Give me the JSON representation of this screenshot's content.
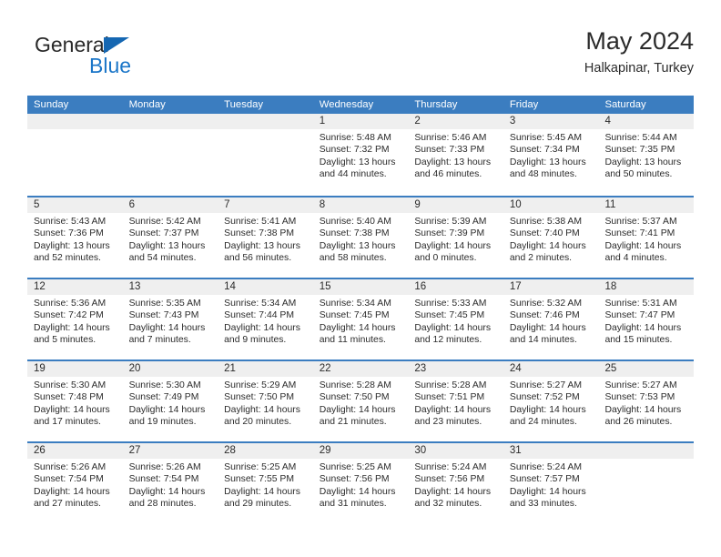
{
  "brand": {
    "name_top": "General",
    "name_bottom": "Blue",
    "triangle_color": "#1567b2",
    "blue_color": "#1b76c8"
  },
  "header": {
    "title": "May 2024",
    "subtitle": "Halkapinar, Turkey"
  },
  "theme": {
    "header_bg": "#3b7dc0",
    "header_text": "#ffffff",
    "day_band_bg": "#efefef",
    "row_separator": "#3b7dc0",
    "body_text": "#2b2b2b"
  },
  "weekday_headers": [
    "Sunday",
    "Monday",
    "Tuesday",
    "Wednesday",
    "Thursday",
    "Friday",
    "Saturday"
  ],
  "weeks": [
    [
      {
        "day": "",
        "lines": []
      },
      {
        "day": "",
        "lines": []
      },
      {
        "day": "",
        "lines": []
      },
      {
        "day": "1",
        "lines": [
          "Sunrise: 5:48 AM",
          "Sunset: 7:32 PM",
          "Daylight: 13 hours",
          "and 44 minutes."
        ]
      },
      {
        "day": "2",
        "lines": [
          "Sunrise: 5:46 AM",
          "Sunset: 7:33 PM",
          "Daylight: 13 hours",
          "and 46 minutes."
        ]
      },
      {
        "day": "3",
        "lines": [
          "Sunrise: 5:45 AM",
          "Sunset: 7:34 PM",
          "Daylight: 13 hours",
          "and 48 minutes."
        ]
      },
      {
        "day": "4",
        "lines": [
          "Sunrise: 5:44 AM",
          "Sunset: 7:35 PM",
          "Daylight: 13 hours",
          "and 50 minutes."
        ]
      }
    ],
    [
      {
        "day": "5",
        "lines": [
          "Sunrise: 5:43 AM",
          "Sunset: 7:36 PM",
          "Daylight: 13 hours",
          "and 52 minutes."
        ]
      },
      {
        "day": "6",
        "lines": [
          "Sunrise: 5:42 AM",
          "Sunset: 7:37 PM",
          "Daylight: 13 hours",
          "and 54 minutes."
        ]
      },
      {
        "day": "7",
        "lines": [
          "Sunrise: 5:41 AM",
          "Sunset: 7:38 PM",
          "Daylight: 13 hours",
          "and 56 minutes."
        ]
      },
      {
        "day": "8",
        "lines": [
          "Sunrise: 5:40 AM",
          "Sunset: 7:38 PM",
          "Daylight: 13 hours",
          "and 58 minutes."
        ]
      },
      {
        "day": "9",
        "lines": [
          "Sunrise: 5:39 AM",
          "Sunset: 7:39 PM",
          "Daylight: 14 hours",
          "and 0 minutes."
        ]
      },
      {
        "day": "10",
        "lines": [
          "Sunrise: 5:38 AM",
          "Sunset: 7:40 PM",
          "Daylight: 14 hours",
          "and 2 minutes."
        ]
      },
      {
        "day": "11",
        "lines": [
          "Sunrise: 5:37 AM",
          "Sunset: 7:41 PM",
          "Daylight: 14 hours",
          "and 4 minutes."
        ]
      }
    ],
    [
      {
        "day": "12",
        "lines": [
          "Sunrise: 5:36 AM",
          "Sunset: 7:42 PM",
          "Daylight: 14 hours",
          "and 5 minutes."
        ]
      },
      {
        "day": "13",
        "lines": [
          "Sunrise: 5:35 AM",
          "Sunset: 7:43 PM",
          "Daylight: 14 hours",
          "and 7 minutes."
        ]
      },
      {
        "day": "14",
        "lines": [
          "Sunrise: 5:34 AM",
          "Sunset: 7:44 PM",
          "Daylight: 14 hours",
          "and 9 minutes."
        ]
      },
      {
        "day": "15",
        "lines": [
          "Sunrise: 5:34 AM",
          "Sunset: 7:45 PM",
          "Daylight: 14 hours",
          "and 11 minutes."
        ]
      },
      {
        "day": "16",
        "lines": [
          "Sunrise: 5:33 AM",
          "Sunset: 7:45 PM",
          "Daylight: 14 hours",
          "and 12 minutes."
        ]
      },
      {
        "day": "17",
        "lines": [
          "Sunrise: 5:32 AM",
          "Sunset: 7:46 PM",
          "Daylight: 14 hours",
          "and 14 minutes."
        ]
      },
      {
        "day": "18",
        "lines": [
          "Sunrise: 5:31 AM",
          "Sunset: 7:47 PM",
          "Daylight: 14 hours",
          "and 15 minutes."
        ]
      }
    ],
    [
      {
        "day": "19",
        "lines": [
          "Sunrise: 5:30 AM",
          "Sunset: 7:48 PM",
          "Daylight: 14 hours",
          "and 17 minutes."
        ]
      },
      {
        "day": "20",
        "lines": [
          "Sunrise: 5:30 AM",
          "Sunset: 7:49 PM",
          "Daylight: 14 hours",
          "and 19 minutes."
        ]
      },
      {
        "day": "21",
        "lines": [
          "Sunrise: 5:29 AM",
          "Sunset: 7:50 PM",
          "Daylight: 14 hours",
          "and 20 minutes."
        ]
      },
      {
        "day": "22",
        "lines": [
          "Sunrise: 5:28 AM",
          "Sunset: 7:50 PM",
          "Daylight: 14 hours",
          "and 21 minutes."
        ]
      },
      {
        "day": "23",
        "lines": [
          "Sunrise: 5:28 AM",
          "Sunset: 7:51 PM",
          "Daylight: 14 hours",
          "and 23 minutes."
        ]
      },
      {
        "day": "24",
        "lines": [
          "Sunrise: 5:27 AM",
          "Sunset: 7:52 PM",
          "Daylight: 14 hours",
          "and 24 minutes."
        ]
      },
      {
        "day": "25",
        "lines": [
          "Sunrise: 5:27 AM",
          "Sunset: 7:53 PM",
          "Daylight: 14 hours",
          "and 26 minutes."
        ]
      }
    ],
    [
      {
        "day": "26",
        "lines": [
          "Sunrise: 5:26 AM",
          "Sunset: 7:54 PM",
          "Daylight: 14 hours",
          "and 27 minutes."
        ]
      },
      {
        "day": "27",
        "lines": [
          "Sunrise: 5:26 AM",
          "Sunset: 7:54 PM",
          "Daylight: 14 hours",
          "and 28 minutes."
        ]
      },
      {
        "day": "28",
        "lines": [
          "Sunrise: 5:25 AM",
          "Sunset: 7:55 PM",
          "Daylight: 14 hours",
          "and 29 minutes."
        ]
      },
      {
        "day": "29",
        "lines": [
          "Sunrise: 5:25 AM",
          "Sunset: 7:56 PM",
          "Daylight: 14 hours",
          "and 31 minutes."
        ]
      },
      {
        "day": "30",
        "lines": [
          "Sunrise: 5:24 AM",
          "Sunset: 7:56 PM",
          "Daylight: 14 hours",
          "and 32 minutes."
        ]
      },
      {
        "day": "31",
        "lines": [
          "Sunrise: 5:24 AM",
          "Sunset: 7:57 PM",
          "Daylight: 14 hours",
          "and 33 minutes."
        ]
      },
      {
        "day": "",
        "lines": []
      }
    ]
  ]
}
